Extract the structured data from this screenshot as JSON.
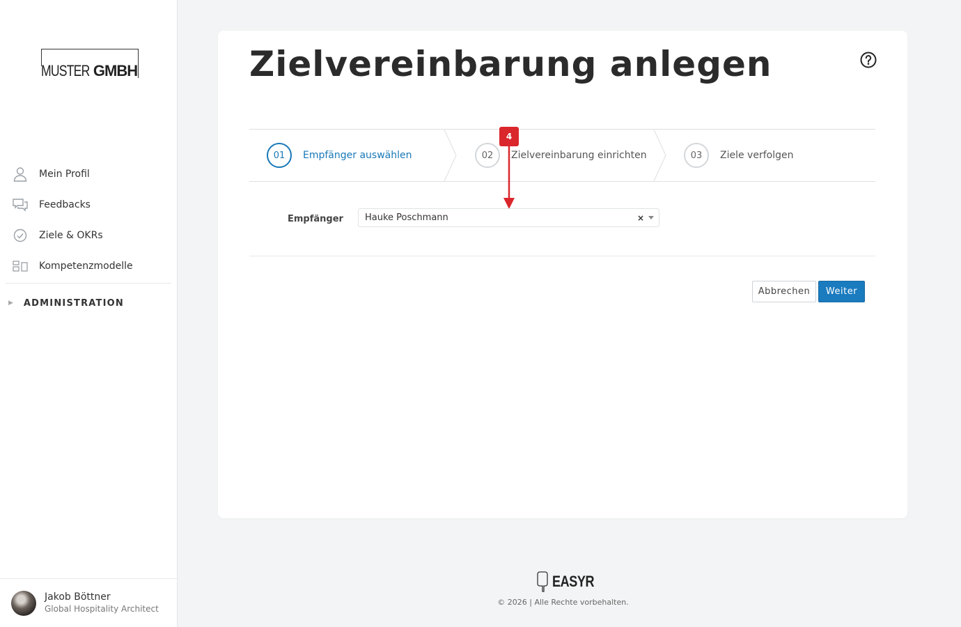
{
  "brand": {
    "logo_thin": "MUSTER",
    "logo_bold": "GMBH"
  },
  "sidebar": {
    "items": [
      {
        "label": "Mein Profil",
        "icon": "user-icon"
      },
      {
        "label": "Feedbacks",
        "icon": "chat-bubbles-icon"
      },
      {
        "label": "Ziele & OKRs",
        "icon": "check-circle-icon"
      },
      {
        "label": "Kompetenzmodelle",
        "icon": "competency-grid-icon"
      }
    ],
    "admin_label": "ADMINISTRATION"
  },
  "user": {
    "name": "Jakob Böttner",
    "role": "Global Hospitality Architect"
  },
  "page": {
    "title": "Zielvereinbarung anlegen"
  },
  "steps": [
    {
      "number": "01",
      "label": "Empfänger auswählen",
      "active": true
    },
    {
      "number": "02",
      "label": "Zielvereinbarung einrichten",
      "active": false
    },
    {
      "number": "03",
      "label": "Ziele verfolgen",
      "active": false
    }
  ],
  "annotation": {
    "badge": "4",
    "color": "#d9272c"
  },
  "form": {
    "recipient_label": "Empfänger",
    "recipient_value": "Hauke Poschmann",
    "clear_symbol": "×"
  },
  "buttons": {
    "cancel": "Abbrechen",
    "next": "Weiter"
  },
  "footer": {
    "logo": "EASYR",
    "copyright": "© 2026 | Alle Rechte vorbehalten."
  },
  "colors": {
    "accent": "#1878b8",
    "primary_button": "#1a7bbf",
    "background": "#f3f4f5"
  }
}
